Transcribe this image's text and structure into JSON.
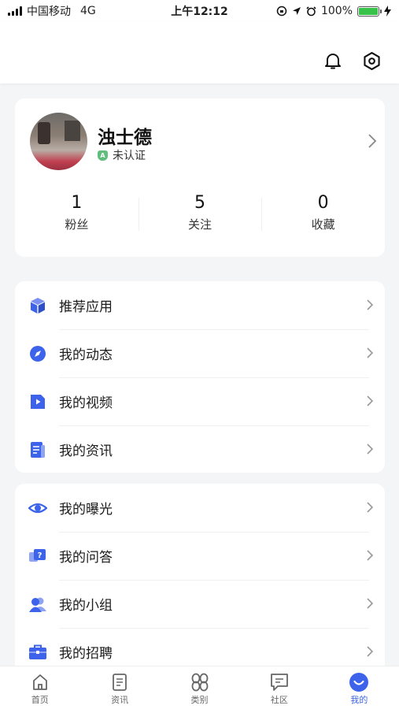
{
  "status_bar": {
    "carrier": "中国移动",
    "network": "4G",
    "time": "上午12:12",
    "battery": "100%"
  },
  "profile": {
    "name": "浊士德",
    "verify_status": "未认证",
    "stats": [
      {
        "value": "1",
        "label": "粉丝"
      },
      {
        "value": "5",
        "label": "关注"
      },
      {
        "value": "0",
        "label": "收藏"
      }
    ]
  },
  "menu_group_1": [
    {
      "label": "推荐应用",
      "icon": "cube-icon"
    },
    {
      "label": "我的动态",
      "icon": "compass-icon"
    },
    {
      "label": "我的视频",
      "icon": "video-icon"
    },
    {
      "label": "我的资讯",
      "icon": "news-icon"
    }
  ],
  "menu_group_2": [
    {
      "label": "我的曝光",
      "icon": "eye-icon"
    },
    {
      "label": "我的问答",
      "icon": "qa-icon"
    },
    {
      "label": "我的小组",
      "icon": "group-icon"
    },
    {
      "label": "我的招聘",
      "icon": "briefcase-icon"
    }
  ],
  "tab_bar": [
    {
      "label": "首页",
      "icon": "home-icon"
    },
    {
      "label": "资讯",
      "icon": "document-icon"
    },
    {
      "label": "类别",
      "icon": "category-icon"
    },
    {
      "label": "社区",
      "icon": "chat-icon"
    },
    {
      "label": "我的",
      "icon": "profile-icon"
    }
  ],
  "colors": {
    "accent": "#3d63ea",
    "background": "#f4f5f7",
    "verified_badge": "#5fbf7a"
  }
}
